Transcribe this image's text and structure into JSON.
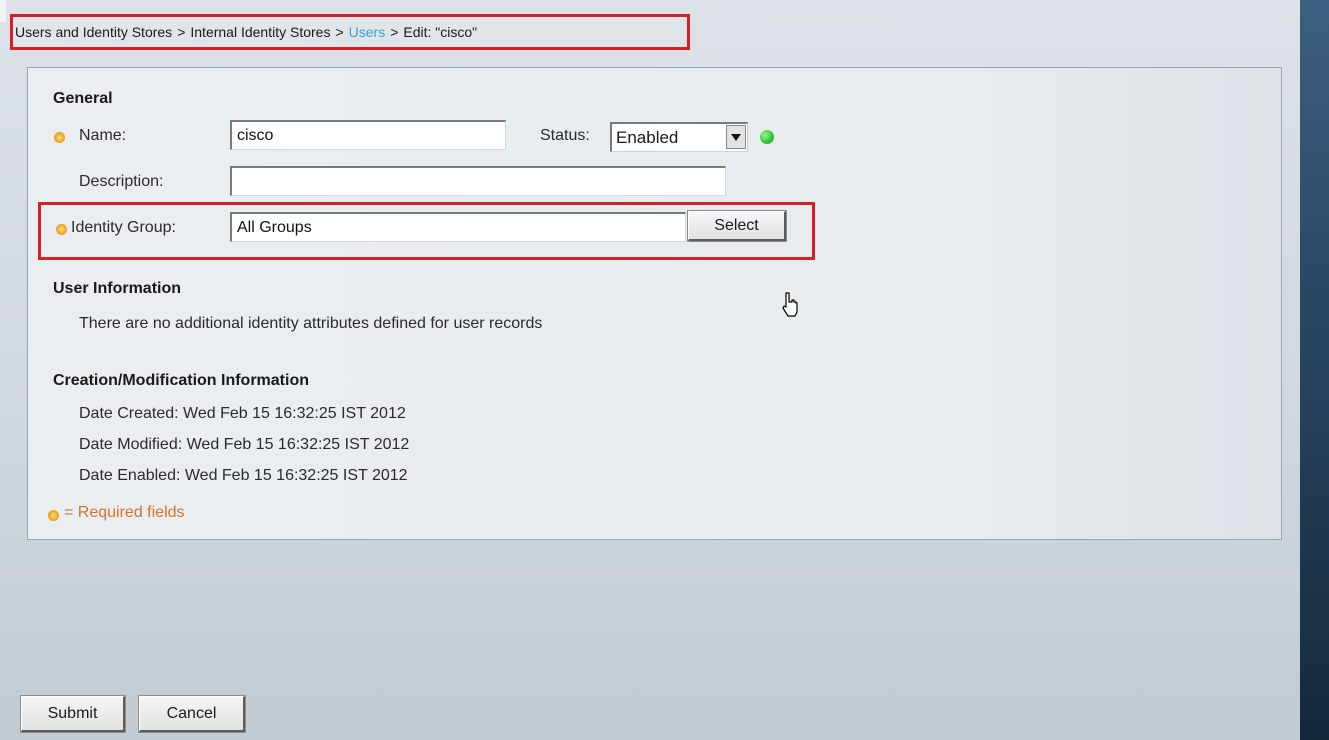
{
  "breadcrumb": {
    "items": [
      "Users and Identity Stores",
      "Internal Identity Stores",
      "Users",
      "Edit: \"cisco\""
    ],
    "separator": ">",
    "link_color": "#3ba0d8"
  },
  "general": {
    "title": "General",
    "name_label": "Name:",
    "name_value": "cisco",
    "status_label": "Status:",
    "status_value": "Enabled",
    "status_indicator_color": "#34c934",
    "description_label": "Description:",
    "description_value": "",
    "identity_group_label": "Identity Group:",
    "identity_group_value": "All Groups",
    "select_button": "Select"
  },
  "user_info": {
    "title": "User Information",
    "text": "There are no additional identity attributes defined for user records"
  },
  "creation": {
    "title": "Creation/Modification Information",
    "created": "Date Created: Wed Feb 15 16:32:25 IST 2012",
    "modified": "Date Modified: Wed Feb 15 16:32:25 IST 2012",
    "enabled": "Date Enabled: Wed Feb 15 16:32:25 IST 2012"
  },
  "required_note": "= Required fields",
  "buttons": {
    "submit": "Submit",
    "cancel": "Cancel"
  },
  "colors": {
    "highlight": "#d62027",
    "required_icon": "#f5a623",
    "required_text": "#d8722a"
  }
}
